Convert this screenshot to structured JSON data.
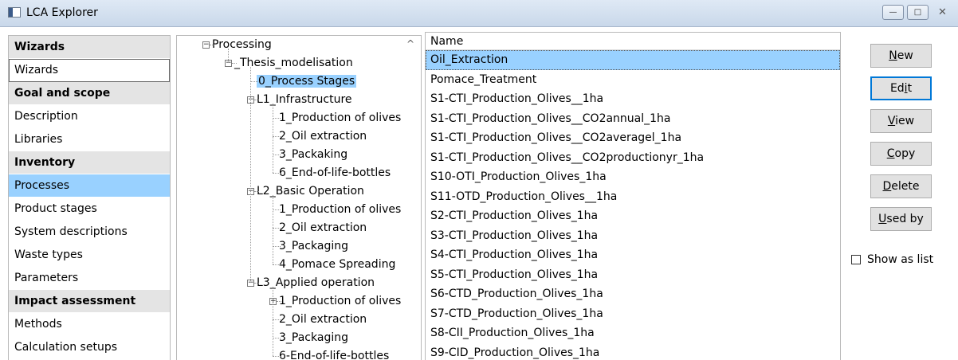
{
  "window": {
    "title": "LCA Explorer",
    "min_label": "—",
    "max_label": "□",
    "close_label": "✕"
  },
  "nav": {
    "items": [
      {
        "label": "Wizards",
        "type": "header"
      },
      {
        "label": "Wizards",
        "type": "item",
        "outlined": true
      },
      {
        "label": "Goal and scope",
        "type": "header"
      },
      {
        "label": "Description",
        "type": "item"
      },
      {
        "label": "Libraries",
        "type": "item"
      },
      {
        "label": "Inventory",
        "type": "header"
      },
      {
        "label": "Processes",
        "type": "item",
        "selected": true
      },
      {
        "label": "Product stages",
        "type": "item"
      },
      {
        "label": "System descriptions",
        "type": "item"
      },
      {
        "label": "Waste types",
        "type": "item"
      },
      {
        "label": "Parameters",
        "type": "item"
      },
      {
        "label": "Impact assessment",
        "type": "header"
      },
      {
        "label": "Methods",
        "type": "item"
      },
      {
        "label": "Calculation setups",
        "type": "item"
      }
    ]
  },
  "tree": {
    "nodes": [
      {
        "label": "Processing",
        "level": 0,
        "expander": "-"
      },
      {
        "label": "_Thesis_modelisation",
        "level": 1,
        "expander": "-"
      },
      {
        "label": "0_Process Stages",
        "level": 2,
        "expander": "",
        "selected": true
      },
      {
        "label": "L1_Infrastructure",
        "level": 2,
        "expander": "-"
      },
      {
        "label": "1_Production of olives",
        "level": 3,
        "expander": ""
      },
      {
        "label": "2_Oil extraction",
        "level": 3,
        "expander": ""
      },
      {
        "label": "3_Packaking",
        "level": 3,
        "expander": ""
      },
      {
        "label": "6_End-of-life-bottles",
        "level": 3,
        "expander": ""
      },
      {
        "label": "L2_Basic Operation",
        "level": 2,
        "expander": "-"
      },
      {
        "label": "1_Production of olives",
        "level": 3,
        "expander": ""
      },
      {
        "label": "2_Oil extraction",
        "level": 3,
        "expander": ""
      },
      {
        "label": "3_Packaging",
        "level": 3,
        "expander": ""
      },
      {
        "label": "4_Pomace Spreading",
        "level": 3,
        "expander": ""
      },
      {
        "label": "L3_Applied operation",
        "level": 2,
        "expander": "-"
      },
      {
        "label": "1_Production of olives",
        "level": 3,
        "expander": "+"
      },
      {
        "label": "2_Oil extraction",
        "level": 3,
        "expander": ""
      },
      {
        "label": "3_Packaging",
        "level": 3,
        "expander": ""
      },
      {
        "label": "6-End-of-life-bottles",
        "level": 3,
        "expander": ""
      }
    ]
  },
  "list": {
    "header": "Name",
    "rows": [
      {
        "name": "Oil_Extraction",
        "selected": true
      },
      {
        "name": "Pomace_Treatment"
      },
      {
        "name": "S1-CTI_Production_Olives__1ha"
      },
      {
        "name": "S1-CTI_Production_Olives__CO2annual_1ha"
      },
      {
        "name": "S1-CTI_Production_Olives__CO2averagel_1ha"
      },
      {
        "name": "S1-CTI_Production_Olives__CO2productionyr_1ha"
      },
      {
        "name": "S10-OTI_Production_Olives_1ha"
      },
      {
        "name": "S11-OTD_Production_Olives__1ha"
      },
      {
        "name": "S2-CTI_Production_Olives_1ha"
      },
      {
        "name": "S3-CTI_Production_Olives_1ha"
      },
      {
        "name": "S4-CTI_Production_Olives_1ha"
      },
      {
        "name": "S5-CTI_Production_Olives_1ha"
      },
      {
        "name": "S6-CTD_Production_Olives_1ha"
      },
      {
        "name": "S7-CTD_Production_Olives_1ha"
      },
      {
        "name": "S8-CII_Production_Olives_1ha"
      },
      {
        "name": "S9-CID_Production_Olives_1ha"
      }
    ]
  },
  "buttons": [
    {
      "key": "new",
      "pre": "",
      "u": "N",
      "post": "ew"
    },
    {
      "key": "edit",
      "pre": "Ed",
      "u": "i",
      "post": "t",
      "default": true
    },
    {
      "key": "view",
      "pre": "",
      "u": "V",
      "post": "iew"
    },
    {
      "key": "copy",
      "pre": "",
      "u": "C",
      "post": "opy"
    },
    {
      "key": "delete",
      "pre": "",
      "u": "D",
      "post": "elete"
    },
    {
      "key": "used-by",
      "pre": "",
      "u": "U",
      "post": "sed by"
    }
  ],
  "show_as_list": {
    "label": "Show as list",
    "checked": false
  },
  "colors": {
    "selection": "#99d1ff",
    "header_bg": "#e4e4e4",
    "default_button_border": "#0078d7"
  }
}
